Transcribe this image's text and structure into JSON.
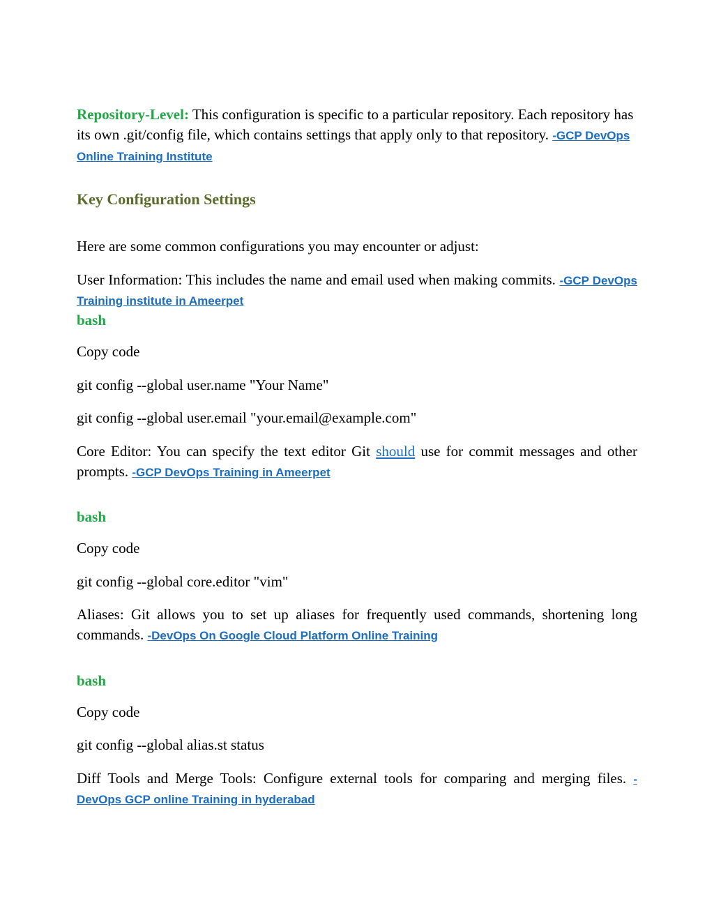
{
  "para1": {
    "boldLabel": "Repository-Level:",
    "text": " This configuration is specific to a particular repository. Each repository has its own .git/config file, which contains settings that apply only to that repository.   ",
    "link": "-GCP DevOps Online Training Institute"
  },
  "heading1": "Key Configuration Settings",
  "para2": "Here are some common configurations you may encounter or adjust:",
  "para3": {
    "text": "User Information: This includes the name and email used when making commits.   ",
    "link": "-GCP DevOps Training institute in Ameerpet"
  },
  "bash1": "bash",
  "copy1": "Copy code",
  "cmd1": "git config --global user.name \"Your Name\"",
  "cmd2": "git config --global user.email \"your.email@example.com\"",
  "para4": {
    "text1": "Core Editor: You can specify the text editor Git ",
    "linkWord": "should",
    "text2": " use for commit messages and other prompts.   ",
    "link": "-GCP DevOps Training in Ameerpet"
  },
  "bash2": "bash",
  "copy2": "Copy code",
  "cmd3": "git config --global core.editor \"vim\"",
  "para5": {
    "text": "Aliases: Git allows you to set up aliases for frequently used commands, shortening long commands.   ",
    "link": "-DevOps On Google Cloud Platform Online Training"
  },
  "bash3": "bash",
  "copy3": "Copy code",
  "cmd4": "git config --global alias.st status",
  "para6": {
    "text": "Diff Tools and Merge Tools: Configure external tools for comparing and merging files.  ",
    "link": "-DevOps GCP online Training in hyderabad"
  }
}
